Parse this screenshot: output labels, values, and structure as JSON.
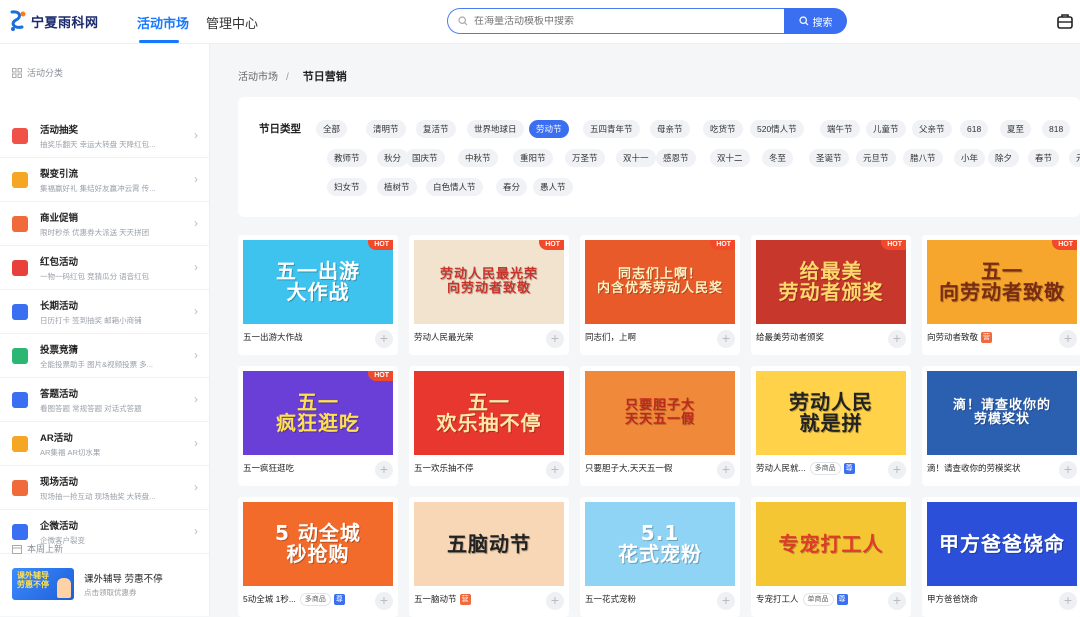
{
  "brand": {
    "name": "宁夏雨科网"
  },
  "nav": {
    "tabs": [
      {
        "label": "活动市场"
      },
      {
        "label": "管理中心"
      }
    ]
  },
  "search": {
    "placeholder": "在海量活动模板中搜索",
    "button": "搜索"
  },
  "sidebar": {
    "section_title": "活动分类",
    "items": [
      {
        "title": "活动抽奖",
        "sub": "抽奖乐翻天   幸运大转盘   天降红包...",
        "color": "#f0524a"
      },
      {
        "title": "裂变引流",
        "sub": "集福赢好礼   集结好友赢冲云霄   传...",
        "color": "#f5a623"
      },
      {
        "title": "商业促销",
        "sub": "限时秒杀   优惠券大派送   天天拼团",
        "color": "#f06a3b"
      },
      {
        "title": "红包活动",
        "sub": "一物一码红包   竞猜瓜分   语音红包",
        "color": "#e8403a"
      },
      {
        "title": "长期活动",
        "sub": "日历打卡   签到抽奖   邮箱小商铺",
        "color": "#3b6ff2"
      },
      {
        "title": "投票竞猜",
        "sub": "全能投票助手   图片&视频投票   多...",
        "color": "#2bb673"
      },
      {
        "title": "答题活动",
        "sub": "看图答题   常规答题   对话式答题",
        "color": "#3b6ff2"
      },
      {
        "title": "AR活动",
        "sub": "AR集福   AR切水果",
        "color": "#f5a623"
      },
      {
        "title": "现场活动",
        "sub": "现场抽一抢互动   现场抽奖   大转盘...",
        "color": "#f06a3b"
      },
      {
        "title": "企微活动",
        "sub": "企微客户裂变",
        "color": "#3b6ff2"
      }
    ],
    "week_title": "本周上新",
    "week_item": {
      "title": "课外辅导 劳惠不停",
      "sub": "点击领取优惠券",
      "thumb_text": "课外辅导 劳惠不停"
    }
  },
  "breadcrumb": {
    "parent": "活动市场",
    "separator": "/",
    "current": "节日营销"
  },
  "filter": {
    "label": "节日类型",
    "rows": [
      [
        "全部",
        "清明节",
        "复活节",
        "世界地球日",
        "劳动节",
        "五四青年节",
        "母亲节",
        "吃货节",
        "520情人节",
        "端午节",
        "儿童节",
        "父亲节",
        "618",
        "夏至",
        "818"
      ],
      [
        "教师节",
        "秋分",
        "国庆节",
        "中秋节",
        "重阳节",
        "万圣节",
        "双十一",
        "感恩节",
        "双十二",
        "冬至",
        "圣诞节",
        "元旦节",
        "腊八节",
        "小年",
        "除夕",
        "春节",
        "元"
      ],
      [
        "妇女节",
        "植树节",
        "白色情人节",
        "春分",
        "愚人节"
      ]
    ],
    "active": "劳动节"
  },
  "cards": [
    {
      "name": "五一出游大作战",
      "hot": "HOT",
      "art": "五一出游\n大作战",
      "bg": "#3ec3ef",
      "fg": "#ffffff"
    },
    {
      "name": "劳动人民最光荣",
      "hot": "HOT",
      "art": "劳动人民最光荣\n向劳动者致敬",
      "bg": "#f2e3cf",
      "fg": "#c9342a"
    },
    {
      "name": "同志们，上啊",
      "hot": "HOT",
      "art": "同志们上啊！\n内含优秀劳动人民奖",
      "bg": "#e95a2b",
      "fg": "#fff3c2"
    },
    {
      "name": "给最美劳动者颁奖",
      "hot": "HOT",
      "art": "给最美\n劳动者颁奖",
      "bg": "#c8372b",
      "fg": "#ffd86b"
    },
    {
      "name": "向劳动者致敬",
      "hot": "HOT",
      "art": "五一\n向劳动者致敬",
      "bg": "#f6a62c",
      "fg": "#7a2b13",
      "badge": "营"
    },
    {
      "name": "五一疯狂逛吃",
      "hot": "HOT",
      "art": "五一\n疯狂逛吃",
      "bg": "#6a3fd8",
      "fg": "#ffe14d"
    },
    {
      "name": "五一欢乐抽不停",
      "hot": "",
      "art": "五一\n欢乐抽不停",
      "bg": "#e8372f",
      "fg": "#ffe9a8"
    },
    {
      "name": "只要胆子大,天天五一假",
      "hot": "",
      "art": "只要胆子大\n天天五一假",
      "bg": "#f08a3a",
      "fg": "#c0281e"
    },
    {
      "name": "劳动人民就...",
      "hot": "",
      "art": "劳动人民\n就是拼",
      "bg": "#ffd24a",
      "fg": "#222222",
      "tag": "多商品",
      "badge2": "尊"
    },
    {
      "name": "滴！请查收你的劳模奖状",
      "hot": "",
      "art": "滴！请查收你的\n劳模奖状",
      "bg": "#2b5fb0",
      "fg": "#ffffff"
    },
    {
      "name": "5动全城 1秒...",
      "hot": "",
      "art": "5 动全城\n秒抢购",
      "bg": "#f36b2a",
      "fg": "#ffffff",
      "tag": "多商品",
      "badge2": "尊"
    },
    {
      "name": "五一脑动节",
      "hot": "",
      "art": "五脑动节",
      "bg": "#f7d7b5",
      "fg": "#222222",
      "badge": "营"
    },
    {
      "name": "五一花式宠粉",
      "hot": "",
      "art": "5.1\n花式宠粉",
      "bg": "#8fd3f5",
      "fg": "#ffffff"
    },
    {
      "name": "专宠打工人",
      "hot": "",
      "art": "专宠打工人",
      "bg": "#f5c634",
      "fg": "#e03a2a",
      "tag": "单商品",
      "badge2": "尊"
    },
    {
      "name": "甲方爸爸饶命",
      "hot": "",
      "art": "甲方爸爸饶命",
      "bg": "#2b4fd9",
      "fg": "#ffffff"
    }
  ]
}
